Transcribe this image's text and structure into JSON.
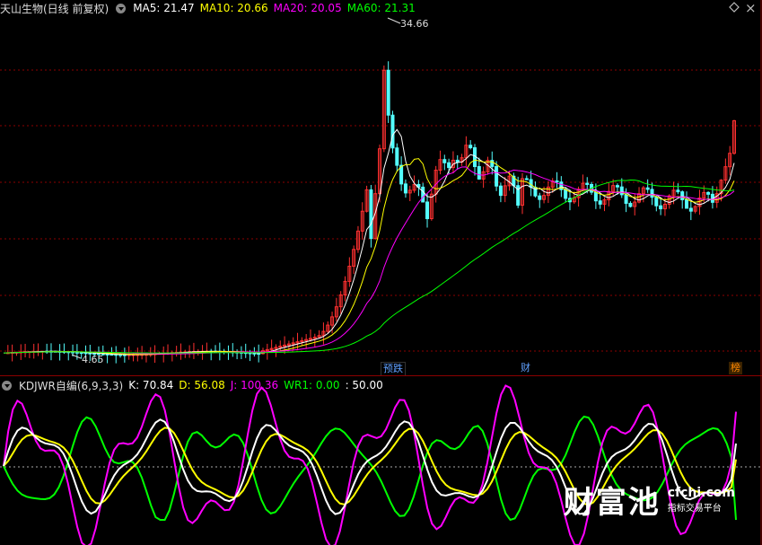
{
  "header": {
    "stock_name": "天山生物(日线 前复权)",
    "ma": [
      {
        "label": "MA5: 21.47",
        "color": "#ffffff"
      },
      {
        "label": "MA10: 20.66",
        "color": "#ffff00"
      },
      {
        "label": "MA20: 20.05",
        "color": "#ff00ff"
      },
      {
        "label": "MA60: 21.31",
        "color": "#00ff00"
      }
    ]
  },
  "price_panel": {
    "high_label": "34.66",
    "low_label": "4.65",
    "colors": {
      "up": "#ff3030",
      "down": "#54ffff",
      "ma5": "#ffffff",
      "ma10": "#ffff00",
      "ma20": "#ff00ff",
      "ma60": "#00ff00"
    },
    "events": [
      {
        "label": "预跌",
        "color": "#60a0ff"
      },
      {
        "label": "财",
        "color": "#60a0ff"
      },
      {
        "label": "榜",
        "color": "#ff8800"
      }
    ]
  },
  "indicator_panel": {
    "title": "KDJWR自编(6,9,3,3)",
    "values": [
      {
        "label": "K: 70.84",
        "color": "#ffffff"
      },
      {
        "label": "D: 56.08",
        "color": "#ffff00"
      },
      {
        "label": "J: 100.36",
        "color": "#ff00ff"
      },
      {
        "label": "WR1: 0.00",
        "color": "#00ff00"
      },
      {
        "label": ": 50.00",
        "color": "#ffffff"
      }
    ]
  },
  "watermark": {
    "big": "财富池",
    "site": "cfchi.com",
    "sub": "指标交易平台"
  },
  "controls": {
    "settings": "◇",
    "close": "×",
    "dropdown": "▾"
  }
}
